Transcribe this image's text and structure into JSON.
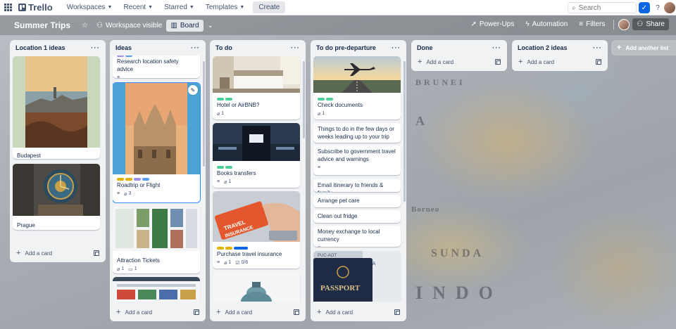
{
  "topnav": {
    "logo": "Trello",
    "menus": [
      "Workspaces",
      "Recent",
      "Starred",
      "Templates"
    ],
    "create": "Create",
    "search_placeholder": "Search"
  },
  "board": {
    "title": "Summer Trips",
    "visibility": "Workspace visible",
    "view": "Board",
    "powerups": "Power-Ups",
    "automation": "Automation",
    "filters": "Filters",
    "share": "Share",
    "add_list": "Add another list"
  },
  "map_labels": [
    "BRUNEI",
    "Borneo",
    "SUNDA",
    "INDO",
    "A"
  ],
  "add_card_label": "Add a card",
  "lists": [
    {
      "title": "Location 1 ideas",
      "cards": [
        {
          "title": "Budapest"
        },
        {
          "title": "Prague"
        }
      ]
    },
    {
      "title": "Ideas",
      "cards": [
        {
          "title": "Research location safety advice"
        },
        {
          "title": "Roadtrip or Flight",
          "attachments": "3"
        },
        {
          "title": "Attraction Tickets",
          "attachments": "1",
          "comments": "1"
        },
        {
          "title": ""
        }
      ]
    },
    {
      "title": "To do",
      "cards": [
        {
          "title": "Hotel or AirBNB?",
          "attachments": "1"
        },
        {
          "title": "Books transfers",
          "attachments": "1"
        },
        {
          "title": "Purchase travel insurance",
          "attachments": "1",
          "checklist": "0/6"
        },
        {
          "title": ""
        }
      ]
    },
    {
      "title": "To do pre-departure",
      "cards": [
        {
          "title": "Check documents",
          "attachments": "1"
        },
        {
          "title": "Things to do in the few days or weeks leading up to your trip"
        },
        {
          "title": "Subscribe to government travel advice and warnings"
        },
        {
          "title": "Email itinerary to friends & family"
        },
        {
          "title": "Arrange pet care"
        },
        {
          "title": "Clean out fridge"
        },
        {
          "title": "Money exchange to local currency"
        },
        {
          "title": ""
        }
      ]
    },
    {
      "title": "Done",
      "cards": []
    },
    {
      "title": "Location 2 ideas",
      "cards": []
    }
  ],
  "colors": {
    "brand": "#0c66e4",
    "label_green": "#4bce97",
    "label_yellow": "#e2b203",
    "label_purple": "#9f8fef",
    "label_blue": "#579dff"
  }
}
